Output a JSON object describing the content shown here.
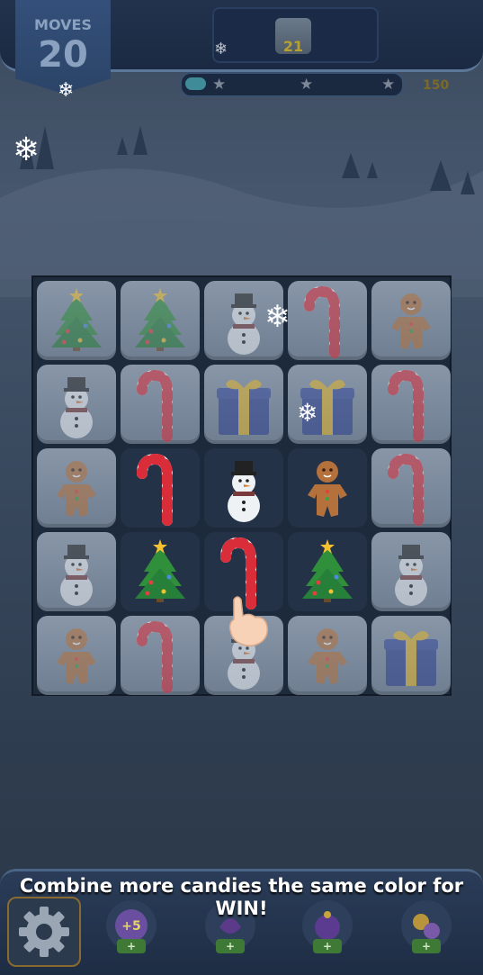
{
  "hud": {
    "moves_label": "MOVES",
    "moves_value": "20",
    "goal_count": "21",
    "score_target": "150",
    "progress_fraction": 0.1
  },
  "board": {
    "rows": [
      [
        "tree",
        "tree",
        "snowman",
        "candy-cane",
        "gingerbread"
      ],
      [
        "snowman",
        "candy-cane",
        "gift",
        "gift",
        "candy-cane"
      ],
      [
        "gingerbread",
        "candy-cane",
        "snowman",
        "gingerbread",
        "candy-cane"
      ],
      [
        "snowman",
        "tree",
        "candy-cane",
        "tree",
        "snowman"
      ],
      [
        "gingerbread",
        "candy-cane",
        "snowman",
        "gingerbread",
        "gift"
      ]
    ],
    "empty_cells": [
      [
        2,
        1
      ],
      [
        2,
        2
      ],
      [
        2,
        3
      ],
      [
        3,
        1
      ],
      [
        3,
        2
      ],
      [
        3,
        3
      ]
    ]
  },
  "tutorial": {
    "message": "Combine more candies the same color for WIN!"
  },
  "boosters": [
    {
      "icon": "plus-five-moves-icon",
      "badge": "+5",
      "add_label": "+"
    },
    {
      "icon": "purple-booster-icon",
      "add_label": "+"
    },
    {
      "icon": "bomb-booster-icon",
      "add_label": "+"
    },
    {
      "icon": "swap-booster-icon",
      "add_label": "+"
    }
  ],
  "colors": {
    "board_bg": "#1c2a3b",
    "cell": "#7f8ea1",
    "candy_red": "#d92e3a",
    "tree_green": "#2f8f3a",
    "gift_blue": "#2c3f8f",
    "gift_ribbon": "#e2b52b"
  }
}
